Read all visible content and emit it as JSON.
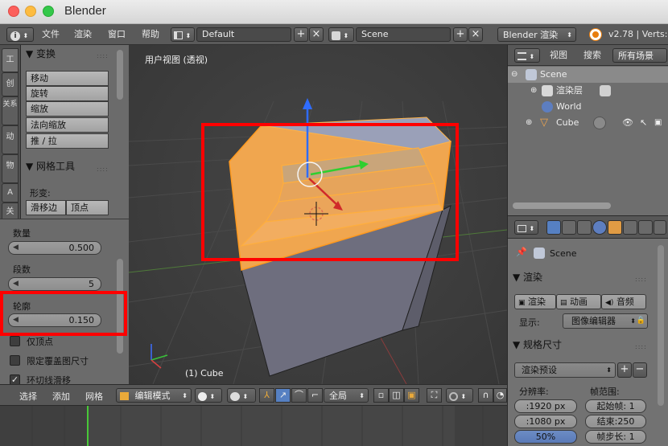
{
  "window": {
    "title": "Blender"
  },
  "top_menu": {
    "file": "文件",
    "render": "渲染",
    "window": "窗口",
    "help": "帮助",
    "screen_layout": "Default",
    "scene": "Scene",
    "engine": "Blender 渲染",
    "version": "v2.78 | Verts:"
  },
  "tool_tabs": [
    "工",
    "创",
    "关系",
    "动",
    "物",
    "A",
    "关"
  ],
  "shelf": {
    "transform_header": "▼ 变换",
    "transform_buttons": [
      "移动",
      "旋转",
      "缩放",
      "法向缩放",
      "推 / 拉"
    ],
    "mesh_tools_header": "▼ 网格工具",
    "deform_label": "形变:",
    "slide_edge": "滑移边",
    "vertex": "顶点"
  },
  "operator": {
    "amount_label": "数量",
    "amount_value": "0.500",
    "segments_label": "段数",
    "segments_value": "5",
    "profile_label": "轮廓",
    "profile_value": "0.150",
    "vertex_only": "仅顶点",
    "clamp_overlap": "限定覆盖图尺寸",
    "loop_slide": "环切线滑移",
    "loop_slide_check": "✓"
  },
  "viewport": {
    "title": "用户视图 (透视)",
    "object_label": "(1) Cube"
  },
  "viewport_header": {
    "select": "选择",
    "add": "添加",
    "mesh": "网格",
    "mode": "编辑模式",
    "pivot": "全局"
  },
  "outliner": {
    "view": "视图",
    "search": "搜索",
    "filter": "所有场景",
    "items": [
      {
        "label": "Scene"
      },
      {
        "label": "渲染层"
      },
      {
        "label": "World"
      },
      {
        "label": "Cube"
      }
    ]
  },
  "properties": {
    "context": "Scene",
    "render_header": "▼ 渲染",
    "render_btn": "渲染",
    "anim_btn": "动画",
    "audio_btn": "音频",
    "display_label": "显示:",
    "display_value": "图像编辑器",
    "dimensions_header": "▼ 规格尺寸",
    "preset": "渲染预设",
    "resolution_label": "分辨率:",
    "frame_range_label": "帧范围:",
    "res_x": ":1920 px",
    "res_y": ":1080 px",
    "res_pct": "50%",
    "start_frame": "起始帧: 1",
    "end_frame": "结束:250",
    "frame_step": "帧步长: 1"
  },
  "colors": {
    "highlight": "#ff0000",
    "selection": "#f5a33c",
    "accent": "#5680c2"
  }
}
